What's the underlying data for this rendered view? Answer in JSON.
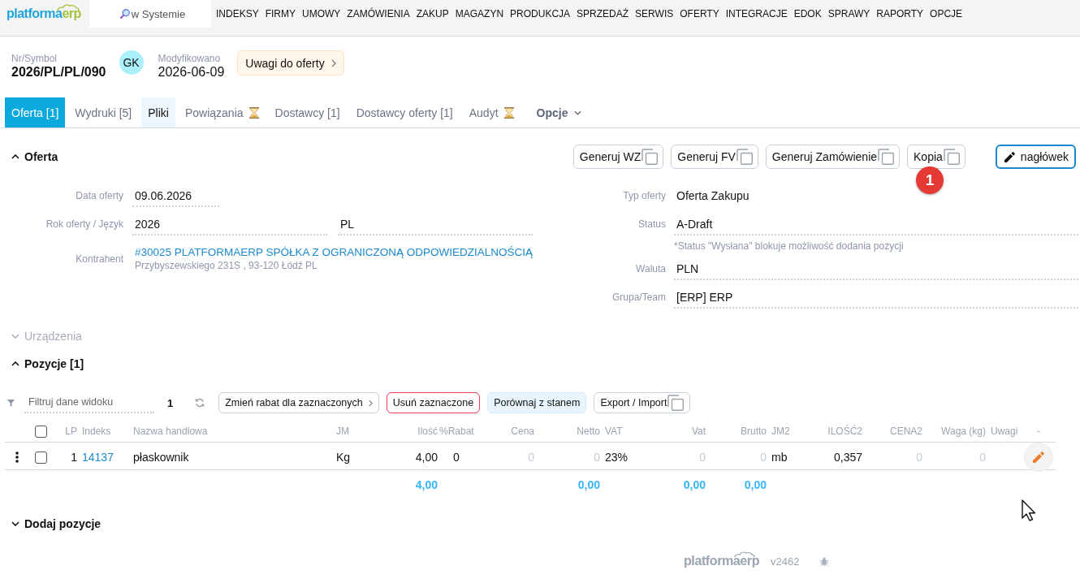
{
  "nav": {
    "logo": {
      "primary": "platforma",
      "accent": "erp"
    },
    "search": {
      "placeholder": "w Systemie"
    },
    "menu": [
      "INDEKSY",
      "FIRMY",
      "UMOWY",
      "ZAMÓWIENIA",
      "ZAKUP",
      "MAGAZYN",
      "PRODUKCJA",
      "SPRZEDAŻ",
      "SERWIS",
      "OFERTY",
      "INTEGRACJE",
      "EDOK",
      "SPRAWY",
      "RAPORTY",
      "OPCJE"
    ]
  },
  "header": {
    "symbol": {
      "label": "Nr/Symbol",
      "value": "2026/PL/PL/090"
    },
    "avatar": {
      "initials": "GK"
    },
    "modified": {
      "label": "Modyfikowano",
      "value": "2026-06-09"
    },
    "notes_button": {
      "label": "Uwagi do oferty"
    }
  },
  "tabs": [
    {
      "label": "Oferta [1]",
      "selected": true,
      "highlighted": false,
      "pending": false
    },
    {
      "label": "Wydruki [5]",
      "selected": false,
      "highlighted": false,
      "pending": false
    },
    {
      "label": "Pliki",
      "selected": false,
      "highlighted": true,
      "pending": false
    },
    {
      "label": "Powiązania",
      "selected": false,
      "highlighted": false,
      "pending": true
    },
    {
      "label": "Dostawcy [1]",
      "selected": false,
      "highlighted": false,
      "pending": false
    },
    {
      "label": "Dostawcy oferty [1]",
      "selected": false,
      "highlighted": false,
      "pending": false
    },
    {
      "label": "Audyt",
      "selected": false,
      "highlighted": false,
      "pending": true
    }
  ],
  "options_menu": {
    "label": "Opcje"
  },
  "offer": {
    "title": "Oferta",
    "expanded": true,
    "disabled": false,
    "actions": [
      {
        "label": "Generuj WZ",
        "kind": "copy"
      },
      {
        "label": "Generuj FV",
        "kind": "copy"
      },
      {
        "label": "Generuj Zamówienie",
        "kind": "copy"
      },
      {
        "label": "Kopia",
        "kind": "copy",
        "marker": "1"
      },
      {
        "label": "nagłówek",
        "kind": "edit"
      }
    ],
    "left_fields": [
      {
        "label": "Data oferty",
        "kind": "input",
        "values": [
          "09.06.2026"
        ]
      },
      {
        "label": "Rok oferty / Język",
        "kind": "input",
        "values": [
          "2026",
          "PL"
        ]
      },
      {
        "label": "Kontrahent",
        "kind": "link",
        "values": [
          "#30025 PLATFORMAERP SPÓŁKA Z OGRANICZONĄ ODPOWIEDZIALNOŚCIĄ"
        ],
        "address": "Przybyszewskiego 231S , 93-120 Łódź PL"
      }
    ],
    "right_fields": [
      {
        "label": "Typ oferty",
        "kind": "text",
        "values": [
          "Oferta Zakupu"
        ]
      },
      {
        "label": "Status",
        "kind": "input",
        "values": [
          "A-Draft"
        ],
        "note": "*Status \"Wysłana\" blokuje możliwość dodania pozycji"
      },
      {
        "label": "Waluta",
        "kind": "input",
        "values": [
          "PLN"
        ]
      },
      {
        "label": "Grupa/Team",
        "kind": "input",
        "values": [
          "[ERP] ERP"
        ]
      }
    ]
  },
  "devices": {
    "title": "Urządzenia",
    "expanded": false,
    "disabled": true
  },
  "positions": {
    "title": "Pozycje [1]",
    "expanded": true,
    "disabled": false,
    "filter": {
      "placeholder": "Filtruj dane widoku"
    },
    "count": "1",
    "actions": [
      {
        "label": "Zmień rabat dla zaznaczonych",
        "kind": "submenu"
      },
      {
        "label": "Usuń zaznaczone",
        "kind": "danger"
      },
      {
        "label": "Porównaj z stanem",
        "kind": "info"
      },
      {
        "label": "Export / Import",
        "kind": "copy"
      }
    ],
    "table": {
      "select_all": {
        "checked": false
      },
      "columns": [
        {
          "label": "LP"
        },
        {
          "label": "Indeks"
        },
        {
          "label": "Nazwa handlowa"
        },
        {
          "label": "JM"
        },
        {
          "label": "Ilość",
          "total": "4,00"
        },
        {
          "label": "%Rabat"
        },
        {
          "label": "Cena"
        },
        {
          "label": "Netto",
          "total": "0,00"
        },
        {
          "label": "VAT"
        },
        {
          "label": "Vat",
          "total": "0,00"
        },
        {
          "label": "Brutto",
          "total": "0,00"
        },
        {
          "label": "JM2"
        },
        {
          "label": "ILOŚĆ2"
        },
        {
          "label": "CENA2"
        },
        {
          "label": "Waga (kg)"
        },
        {
          "label": "Uwagi"
        },
        {
          "label": "-"
        }
      ],
      "rows": [
        {
          "selected": false,
          "cells": [
            {
              "kind": "number",
              "text": "1"
            },
            {
              "kind": "link",
              "text": "14137"
            },
            {
              "kind": "text",
              "text": "płaskownik"
            },
            {
              "kind": "text",
              "text": "Kg"
            },
            {
              "kind": "number",
              "text": "4,00"
            },
            {
              "kind": "number",
              "text": "0"
            },
            {
              "kind": "zero",
              "text": "0"
            },
            {
              "kind": "zero",
              "text": "0"
            },
            {
              "kind": "text",
              "text": "23%"
            },
            {
              "kind": "zero",
              "text": "0"
            },
            {
              "kind": "zero",
              "text": "0"
            },
            {
              "kind": "text",
              "text": "mb"
            },
            {
              "kind": "number",
              "text": "0,357"
            },
            {
              "kind": "zero",
              "text": "0"
            },
            {
              "kind": "zero",
              "text": "0"
            }
          ]
        }
      ]
    }
  },
  "add_item": {
    "title": "Dodaj pozycje",
    "expanded": false,
    "disabled": false
  },
  "footer": {
    "logo": {
      "primary": "platforma",
      "accent": "erp"
    },
    "version": "v2462"
  }
}
